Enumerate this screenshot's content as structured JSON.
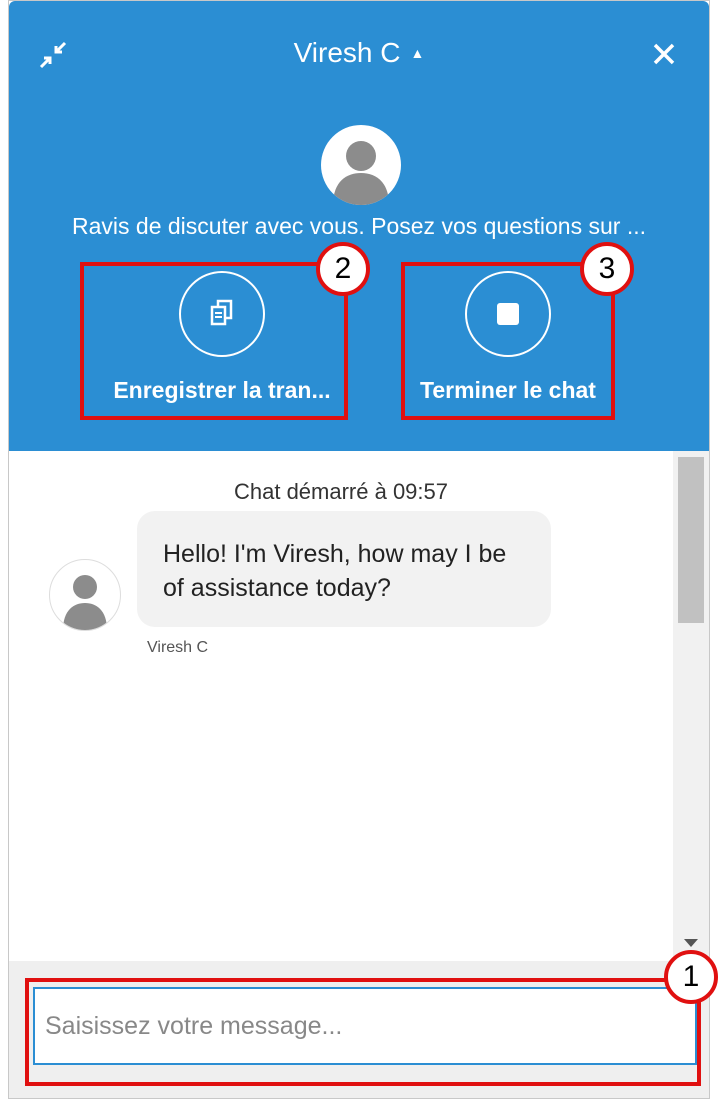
{
  "header": {
    "agent_name": "Viresh C",
    "caret": "▲",
    "welcome_text": "Ravis de discuter avec vous. Posez vos questions sur ...",
    "actions": [
      {
        "label": "Enregistrer la tran...",
        "icon": "save-transcript-icon"
      },
      {
        "label": "Terminer le chat",
        "icon": "stop-icon"
      }
    ],
    "colors": {
      "accent": "#2b8ed3"
    }
  },
  "chat": {
    "started_text": "Chat démarré à 09:57",
    "messages": [
      {
        "text": "Hello! I'm Viresh, how may I be of assistance today?",
        "sender": "Viresh C"
      }
    ]
  },
  "composer": {
    "placeholder": "Saisissez votre message..."
  },
  "annotations": {
    "badges": [
      "1",
      "2",
      "3"
    ],
    "color": "#e01010"
  }
}
